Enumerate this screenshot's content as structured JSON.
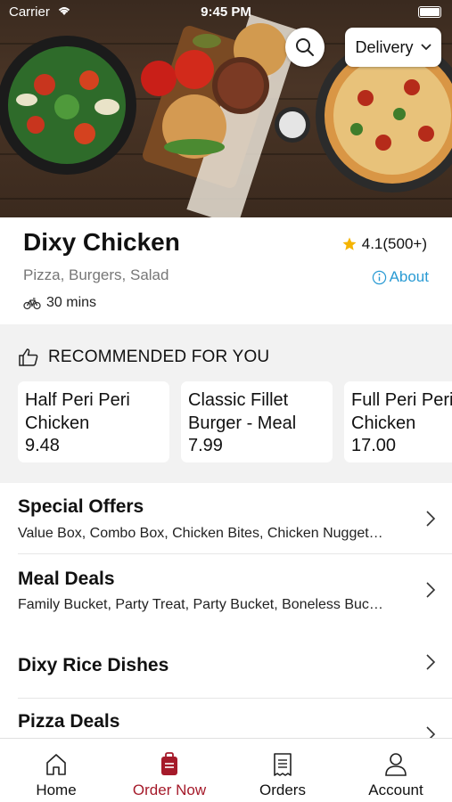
{
  "status_bar": {
    "carrier": "Carrier",
    "time": "9:45 PM"
  },
  "header": {
    "delivery_label": "Delivery",
    "search_icon": "search-icon"
  },
  "restaurant": {
    "name": "Dixy Chicken",
    "rating": "4.1(500+)",
    "cuisines": "Pizza, Burgers, Salad",
    "about_label": "About",
    "delivery_time": "30 mins"
  },
  "recommended": {
    "heading": "RECOMMENDED FOR YOU",
    "items": [
      {
        "name": "Half Peri Peri\nChicken",
        "price": "9.48"
      },
      {
        "name": "Classic Fillet\nBurger - Meal",
        "price": "7.99"
      },
      {
        "name": "Full Peri Peri\nChicken",
        "price": "17.00"
      }
    ]
  },
  "menu": [
    {
      "title": "Special Offers",
      "subtitle": "Value Box, Combo Box, Chicken Bites, Chicken Nugget…"
    },
    {
      "title": "Meal Deals",
      "subtitle": "Family Bucket, Party Treat, Party Bucket, Boneless Buc…"
    },
    {
      "title": "Dixy Rice Dishes",
      "subtitle": ""
    },
    {
      "title": "Pizza Deals",
      "subtitle": ""
    }
  ],
  "tabs": [
    {
      "label": "Home",
      "icon": "home-icon"
    },
    {
      "label": "Order Now",
      "icon": "order-bag-icon"
    },
    {
      "label": "Orders",
      "icon": "orders-receipt-icon"
    },
    {
      "label": "Account",
      "icon": "account-icon"
    }
  ],
  "colors": {
    "accent": "#a51a2a",
    "link": "#2a9bd4",
    "star": "#f5b400"
  }
}
